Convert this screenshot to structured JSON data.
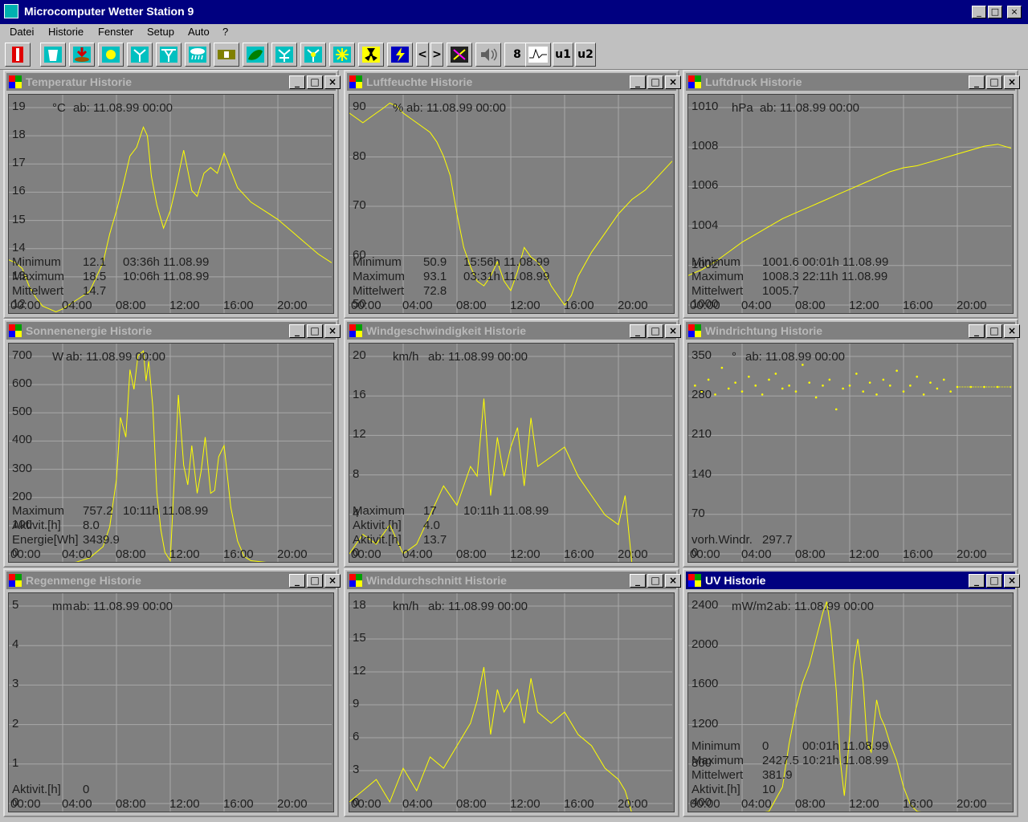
{
  "app": {
    "title": "Microcomputer Wetter Station 9"
  },
  "menu": [
    "Datei",
    "Historie",
    "Fenster",
    "Setup",
    "Auto",
    "?"
  ],
  "toolbar": {
    "items": [
      "thermometer-icon",
      "water-glass-icon",
      "rain-gauge-icon",
      "sun-icon",
      "wind-icon",
      "wind-speed-icon",
      "rain-cloud-icon",
      "battery-icon",
      "leaf-icon",
      "wind-avg-icon",
      "wind-gust-icon",
      "sun-burst-icon",
      "radiation-icon",
      "lightning-icon",
      "prev-arrow",
      "next-arrow",
      "compass-icon",
      "speaker-icon",
      "digit-display-icon",
      "waveform-icon",
      "u1",
      "u2"
    ],
    "prev": "<",
    "next": ">",
    "digit": "8",
    "u1": "u1",
    "u2": "u2"
  },
  "colors": {
    "trace": "#ffff00",
    "plot_bg": "#808080",
    "grid": "#a8a8a8",
    "text": "#1e1e1e",
    "active_title": "#000080"
  },
  "panels": [
    {
      "title": "Temperatur Historie",
      "unit": "°C",
      "since": "ab: 11.08.99 00:00",
      "yticks": [
        "19",
        "18",
        "17",
        "16",
        "15",
        "14",
        "13",
        "12"
      ],
      "xticks": [
        "00:00",
        "04:00",
        "08:00",
        "12:00",
        "16:00",
        "20:00"
      ],
      "stats": [
        [
          "Minimum",
          "12.1",
          "03:36h 11.08.99"
        ],
        [
          "Maximum",
          "18.5",
          "10:06h 11.08.99"
        ],
        [
          "Mittelwert",
          "14.7",
          ""
        ]
      ],
      "chart_data": {
        "type": "line",
        "x_hours": [
          0,
          0.5,
          1,
          1.5,
          2,
          2.5,
          3,
          3.5,
          4,
          5,
          6,
          7,
          7.5,
          8,
          8.5,
          9,
          9.5,
          10,
          10.3,
          10.6,
          11,
          11.5,
          12,
          12.5,
          13,
          13.3,
          13.6,
          14,
          14.5,
          15,
          15.5,
          16,
          16.5,
          17,
          18,
          19,
          20,
          21,
          22,
          23,
          24
        ],
        "values": [
          13.9,
          13.8,
          13.6,
          13.0,
          12.6,
          12.3,
          12.2,
          12.1,
          12.2,
          12.5,
          12.8,
          13.8,
          14.8,
          15.6,
          16.5,
          17.5,
          17.8,
          18.5,
          18.2,
          16.8,
          15.8,
          15.0,
          15.6,
          16.6,
          17.7,
          17.0,
          16.3,
          16.1,
          16.9,
          17.1,
          16.9,
          17.6,
          17.0,
          16.4,
          15.9,
          15.6,
          15.3,
          14.9,
          14.5,
          14.1,
          13.8
        ],
        "ylim": [
          12,
          19.4
        ]
      }
    },
    {
      "title": "Luftfeuchte Historie",
      "unit": "%",
      "since": "ab: 11.08.99 00:00",
      "yticks": [
        "90",
        "80",
        "70",
        "60",
        "50"
      ],
      "xticks": [
        "00:00",
        "04:00",
        "08:00",
        "12:00",
        "16:00",
        "20:00"
      ],
      "stats": [
        [
          "Minimum",
          "50.9",
          "15:56h 11.08.99"
        ],
        [
          "Maximum",
          "93.1",
          "03:31h 11.08.99"
        ],
        [
          "Mittelwert",
          "72.8",
          ""
        ]
      ],
      "chart_data": {
        "type": "line",
        "x_hours": [
          0,
          0.5,
          1,
          1.5,
          2,
          2.5,
          3,
          3.5,
          4,
          5,
          6,
          6.5,
          7,
          7.5,
          8,
          8.5,
          9,
          9.5,
          10,
          10.5,
          11,
          11.5,
          12,
          12.5,
          13,
          13.5,
          14,
          14.5,
          15,
          15.5,
          16,
          16.5,
          17,
          18,
          19,
          20,
          21,
          22,
          23,
          24
        ],
        "values": [
          91,
          90,
          89,
          90,
          91,
          92,
          93.1,
          92.5,
          91,
          89,
          87,
          85,
          82,
          78,
          70,
          63,
          59,
          56,
          55,
          57,
          60,
          56,
          54,
          58,
          63,
          61,
          60,
          58,
          55,
          53,
          51,
          53,
          57,
          62,
          66,
          70,
          73,
          75,
          78,
          81
        ],
        "ylim": [
          49,
          93.5
        ]
      }
    },
    {
      "title": "Luftdruck Historie",
      "unit": "hPa",
      "since": "ab: 11.08.99 00:00",
      "yticks": [
        "1010",
        "1008",
        "1006",
        "1004",
        "1002",
        "1000"
      ],
      "xticks": [
        "00:00",
        "04:00",
        "08:00",
        "12:00",
        "16:00",
        "20:00"
      ],
      "stats": [
        [
          "Minimum",
          "1001.6",
          "00:01h 11.08.99"
        ],
        [
          "Maximum",
          "1008.3",
          "22:11h 11.08.99"
        ],
        [
          "Mittelwert",
          "1005.7",
          ""
        ]
      ],
      "chart_data": {
        "type": "line",
        "x_hours": [
          0,
          1,
          2,
          3,
          4,
          5,
          6,
          7,
          8,
          9,
          10,
          11,
          12,
          13,
          14,
          15,
          16,
          17,
          18,
          19,
          20,
          21,
          22,
          23,
          24
        ],
        "values": [
          1001.6,
          1001.9,
          1002.3,
          1002.8,
          1003.3,
          1003.7,
          1004.1,
          1004.5,
          1004.8,
          1005.1,
          1005.4,
          1005.7,
          1006.0,
          1006.3,
          1006.6,
          1006.9,
          1007.1,
          1007.2,
          1007.4,
          1007.6,
          1007.8,
          1008.0,
          1008.2,
          1008.3,
          1008.1
        ],
        "ylim": [
          999.6,
          1010.5
        ]
      }
    },
    {
      "title": "Sonnenenergie Historie",
      "unit": "W",
      "since": "ab: 11.08.99 00:00",
      "yticks": [
        "700",
        "600",
        "500",
        "400",
        "300",
        "200",
        "100",
        "0"
      ],
      "xticks": [
        "00:00",
        "04:00",
        "08:00",
        "12:00",
        "16:00",
        "20:00"
      ],
      "stats": [
        [
          "Maximum",
          "757.2",
          "10:11h 11.08.99"
        ],
        [
          "Aktivit.[h]",
          "8.0",
          ""
        ],
        [
          "Energie[Wh]",
          "3439.9",
          ""
        ]
      ],
      "chart_data": {
        "type": "line",
        "x_hours": [
          0,
          4,
          5,
          6,
          7,
          7.5,
          8,
          8.3,
          8.7,
          9,
          9.3,
          9.6,
          10,
          10.2,
          10.4,
          10.7,
          11,
          11.3,
          11.6,
          12,
          12.3,
          12.6,
          13,
          13.3,
          13.6,
          14,
          14.3,
          14.6,
          15,
          15.3,
          15.6,
          16,
          16.5,
          17,
          17.5,
          18,
          19,
          20,
          24
        ],
        "values": [
          0,
          0,
          5,
          20,
          60,
          130,
          300,
          520,
          450,
          690,
          620,
          740,
          757,
          650,
          720,
          560,
          250,
          120,
          40,
          10,
          300,
          600,
          350,
          280,
          420,
          250,
          330,
          450,
          250,
          260,
          380,
          420,
          200,
          80,
          25,
          10,
          5,
          0,
          0
        ],
        "ylim": [
          0,
          760
        ]
      }
    },
    {
      "title": "Windgeschwindigkeit Historie",
      "unit": "km/h",
      "since": "ab: 11.08.99 00:00",
      "yticks": [
        "20",
        "16",
        "12",
        "8",
        "4",
        "0"
      ],
      "xticks": [
        "00:00",
        "04:00",
        "08:00",
        "12:00",
        "16:00",
        "20:00"
      ],
      "stats": [
        [
          "Maximum",
          "17",
          "10:11h 11.08.99"
        ],
        [
          "Aktivit.[h]",
          "4.0",
          ""
        ],
        [
          "Aktivit.[h]",
          "13.7",
          ""
        ]
      ],
      "chart_data": {
        "type": "line",
        "x_hours": [
          0,
          1,
          2,
          3,
          4,
          5,
          6,
          7,
          8,
          9,
          9.5,
          10,
          10.5,
          11,
          11.5,
          12,
          12.5,
          13,
          13.5,
          14,
          15,
          16,
          17,
          18,
          19,
          20,
          20.5,
          21,
          24
        ],
        "values": [
          1,
          3,
          2,
          4,
          1,
          2,
          5,
          8,
          6,
          10,
          9,
          17,
          7,
          13,
          9,
          12,
          14,
          8,
          15,
          10,
          11,
          12,
          9,
          7,
          5,
          4,
          7,
          0,
          0
        ],
        "ylim": [
          0,
          22
        ]
      }
    },
    {
      "title": "Windrichtung Historie",
      "unit": "°",
      "since": "ab: 11.08.99 00:00",
      "yticks": [
        "350",
        "280",
        "210",
        "140",
        "70",
        "0"
      ],
      "xticks": [
        "00:00",
        "04:00",
        "08:00",
        "12:00",
        "16:00",
        "20:00"
      ],
      "stats": [
        [
          "vorh.Windr.",
          "297.7",
          ""
        ]
      ],
      "chart_data": {
        "type": "scatter",
        "x_hours": [
          0.5,
          1,
          1.5,
          2,
          2.5,
          3,
          3.5,
          4,
          4.5,
          5,
          5.5,
          6,
          6.5,
          7,
          7.5,
          8,
          8.5,
          9,
          9.5,
          10,
          10.5,
          11,
          11.5,
          12,
          12.5,
          13,
          13.5,
          14,
          14.5,
          15,
          15.5,
          16,
          16.5,
          17,
          17.5,
          18,
          18.5,
          19,
          19.5,
          20,
          21,
          22,
          23,
          24
        ],
        "values": [
          300,
          290,
          310,
          285,
          330,
          295,
          305,
          290,
          315,
          300,
          285,
          310,
          320,
          295,
          300,
          290,
          335,
          305,
          280,
          300,
          310,
          260,
          295,
          300,
          320,
          290,
          305,
          285,
          310,
          300,
          325,
          290,
          300,
          315,
          285,
          305,
          295,
          310,
          290,
          297.7,
          297.7,
          297.7,
          297.7,
          297.7
        ],
        "ylim": [
          0,
          360
        ]
      }
    },
    {
      "title": "Regenmenge Historie",
      "unit": "mm",
      "since": "ab: 11.08.99 00:00",
      "yticks": [
        "5",
        "4",
        "3",
        "2",
        "1",
        "0"
      ],
      "xticks": [
        "00:00",
        "04:00",
        "08:00",
        "12:00",
        "16:00",
        "20:00"
      ],
      "stats": [
        [
          "Aktivit.[h]",
          "0",
          ""
        ]
      ],
      "chart_data": {
        "type": "line",
        "x_hours": [
          0,
          24
        ],
        "values": [
          0,
          0
        ],
        "ylim": [
          0,
          5.2
        ]
      }
    },
    {
      "title": "Winddurchschnitt   Historie",
      "unit": "km/h",
      "since": "ab: 11.08.99 00:00",
      "yticks": [
        "18",
        "15",
        "12",
        "9",
        "6",
        "3",
        "0"
      ],
      "xticks": [
        "00:00",
        "04:00",
        "08:00",
        "12:00",
        "16:00",
        "20:00"
      ],
      "stats": [],
      "chart_data": {
        "type": "line",
        "x_hours": [
          0,
          1,
          2,
          3,
          4,
          5,
          6,
          7,
          8,
          9,
          9.5,
          10,
          10.5,
          11,
          11.5,
          12,
          12.5,
          13,
          13.5,
          14,
          15,
          16,
          17,
          18,
          19,
          20,
          20.5,
          21,
          24
        ],
        "values": [
          1,
          2,
          3,
          1,
          4,
          2,
          5,
          4,
          6,
          8,
          10,
          13,
          7,
          11,
          9,
          10,
          11,
          8,
          12,
          9,
          8,
          9,
          7,
          6,
          4,
          3,
          2,
          0,
          0
        ],
        "ylim": [
          0,
          19
        ]
      }
    },
    {
      "title": "UV Historie",
      "unit": "mW/m2",
      "since": "ab: 11.08.99 00:00",
      "yticks": [
        "2400",
        "2000",
        "1600",
        "1200",
        "800",
        "400"
      ],
      "xticks": [
        "00:00",
        "04:00",
        "08:00",
        "12:00",
        "16:00",
        "20:00"
      ],
      "stats": [
        [
          "Minimum",
          "0",
          "00:01h 11.08.99"
        ],
        [
          "Maximum",
          "2427.5",
          "10:21h 11.08.99"
        ],
        [
          "Mittelwert",
          "381.9",
          ""
        ],
        [
          "Aktivit.[h]",
          "10",
          ""
        ]
      ],
      "chart_data": {
        "type": "line",
        "x_hours": [
          0,
          5,
          6,
          7,
          7.5,
          8,
          8.5,
          9,
          9.5,
          10,
          10.3,
          10.6,
          11,
          11.3,
          11.6,
          12,
          12.3,
          12.6,
          13,
          13.3,
          13.6,
          14,
          14.3,
          14.6,
          15,
          15.5,
          16,
          16.5,
          17,
          18,
          24
        ],
        "values": [
          0,
          0,
          20,
          300,
          800,
          1200,
          1500,
          1700,
          2000,
          2300,
          2427,
          2100,
          1400,
          600,
          200,
          900,
          1700,
          2000,
          1500,
          800,
          700,
          1300,
          1100,
          1000,
          800,
          600,
          300,
          100,
          20,
          0,
          0
        ],
        "ylim": [
          0,
          2450
        ]
      }
    }
  ]
}
